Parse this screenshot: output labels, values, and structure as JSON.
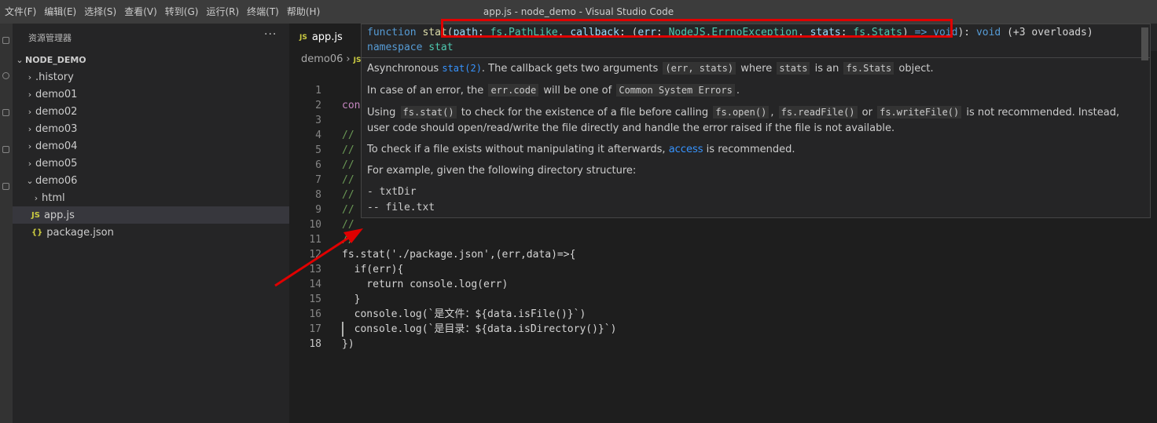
{
  "window_title": "app.js - node_demo - Visual Studio Code",
  "menu": [
    "文件(F)",
    "编辑(E)",
    "选择(S)",
    "查看(V)",
    "转到(G)",
    "运行(R)",
    "终端(T)",
    "帮助(H)"
  ],
  "sidebar": {
    "title": "资源管理器",
    "more": "···",
    "root": "NODE_DEMO",
    "items": [
      {
        "label": ".history",
        "type": "folder"
      },
      {
        "label": "demo01",
        "type": "folder"
      },
      {
        "label": "demo02",
        "type": "folder"
      },
      {
        "label": "demo03",
        "type": "folder"
      },
      {
        "label": "demo04",
        "type": "folder"
      },
      {
        "label": "demo05",
        "type": "folder"
      },
      {
        "label": "demo06",
        "type": "folder-open"
      },
      {
        "label": "html",
        "type": "folder"
      },
      {
        "label": "app.js",
        "type": "js",
        "icon": "JS"
      },
      {
        "label": "package.json",
        "type": "json",
        "icon": "{}"
      }
    ]
  },
  "tab": {
    "label": "app.js",
    "icon": "JS"
  },
  "breadcrumb": {
    "folder": "demo06",
    "sep": "›",
    "file_icon": "JS"
  },
  "editor_lines": [
    {
      "n": "1",
      "code": "con"
    },
    {
      "n": "2",
      "code": ""
    },
    {
      "n": "3",
      "code": "//"
    },
    {
      "n": "4",
      "code": "//"
    },
    {
      "n": "5",
      "code": "//"
    },
    {
      "n": "6",
      "code": "//"
    },
    {
      "n": "7",
      "code": "//"
    },
    {
      "n": "8",
      "code": "//"
    },
    {
      "n": "9",
      "code": "//"
    },
    {
      "n": "10",
      "code": "//"
    },
    {
      "n": "11",
      "code": "fs.stat('./package.json',(err,data)=>{"
    },
    {
      "n": "12",
      "code": "  if(err){"
    },
    {
      "n": "13",
      "code": "    return console.log(err)"
    },
    {
      "n": "14",
      "code": "  }"
    },
    {
      "n": "15",
      "code": "  console.log(`是文件：${data.isFile()}`)"
    },
    {
      "n": "16",
      "code": "  console.log(`是目录：${data.isDirectory()}`)"
    },
    {
      "n": "17",
      "code": "})"
    },
    {
      "n": "18",
      "code": ""
    }
  ],
  "hover": {
    "signature_parts": {
      "kw_function": "function",
      "name": "stat",
      "p1": "path",
      "t1": "fs.PathLike",
      "p2": "callback",
      "p3": "err",
      "t3": "NodeJS.ErrnoException",
      "p4": "stats",
      "t4": "fs.Stats",
      "arrow": "=>",
      "ret": "void",
      "tail_ret": "void",
      "overloads": "+3 overloads",
      "namespace_kw": "namespace",
      "namespace_name": "stat"
    },
    "doc": {
      "p1_a": "Asynchronous",
      "p1_link": "stat(2)",
      "p1_b": ". The callback gets two arguments",
      "p1_code1": "(err, stats)",
      "p1_c": "where",
      "p1_code2": "stats",
      "p1_d": "is an",
      "p1_code3": "fs.Stats",
      "p1_e": "object.",
      "p2_a": "In case of an error, the",
      "p2_code1": "err.code",
      "p2_b": "will be one of",
      "p2_code2": "Common System Errors",
      "p2_c": ".",
      "p3_a": "Using",
      "p3_code1": "fs.stat()",
      "p3_b": "to check for the existence of a file before calling",
      "p3_code2": "fs.open()",
      "p3_c": ",",
      "p3_code3": "fs.readFile()",
      "p3_d": "or",
      "p3_code4": "fs.writeFile()",
      "p3_e": "is not recommended. Instead, user code should open/read/write the file directly and handle the error raised if the file is not available.",
      "p4_a": "To check if a file exists without manipulating it afterwards,",
      "p4_link": "access",
      "p4_b": "is recommended.",
      "p5": "For example, given the following directory structure:",
      "pre1": "- txtDir",
      "pre2": "-- file.txt"
    }
  },
  "annotation_color": "#e00000"
}
